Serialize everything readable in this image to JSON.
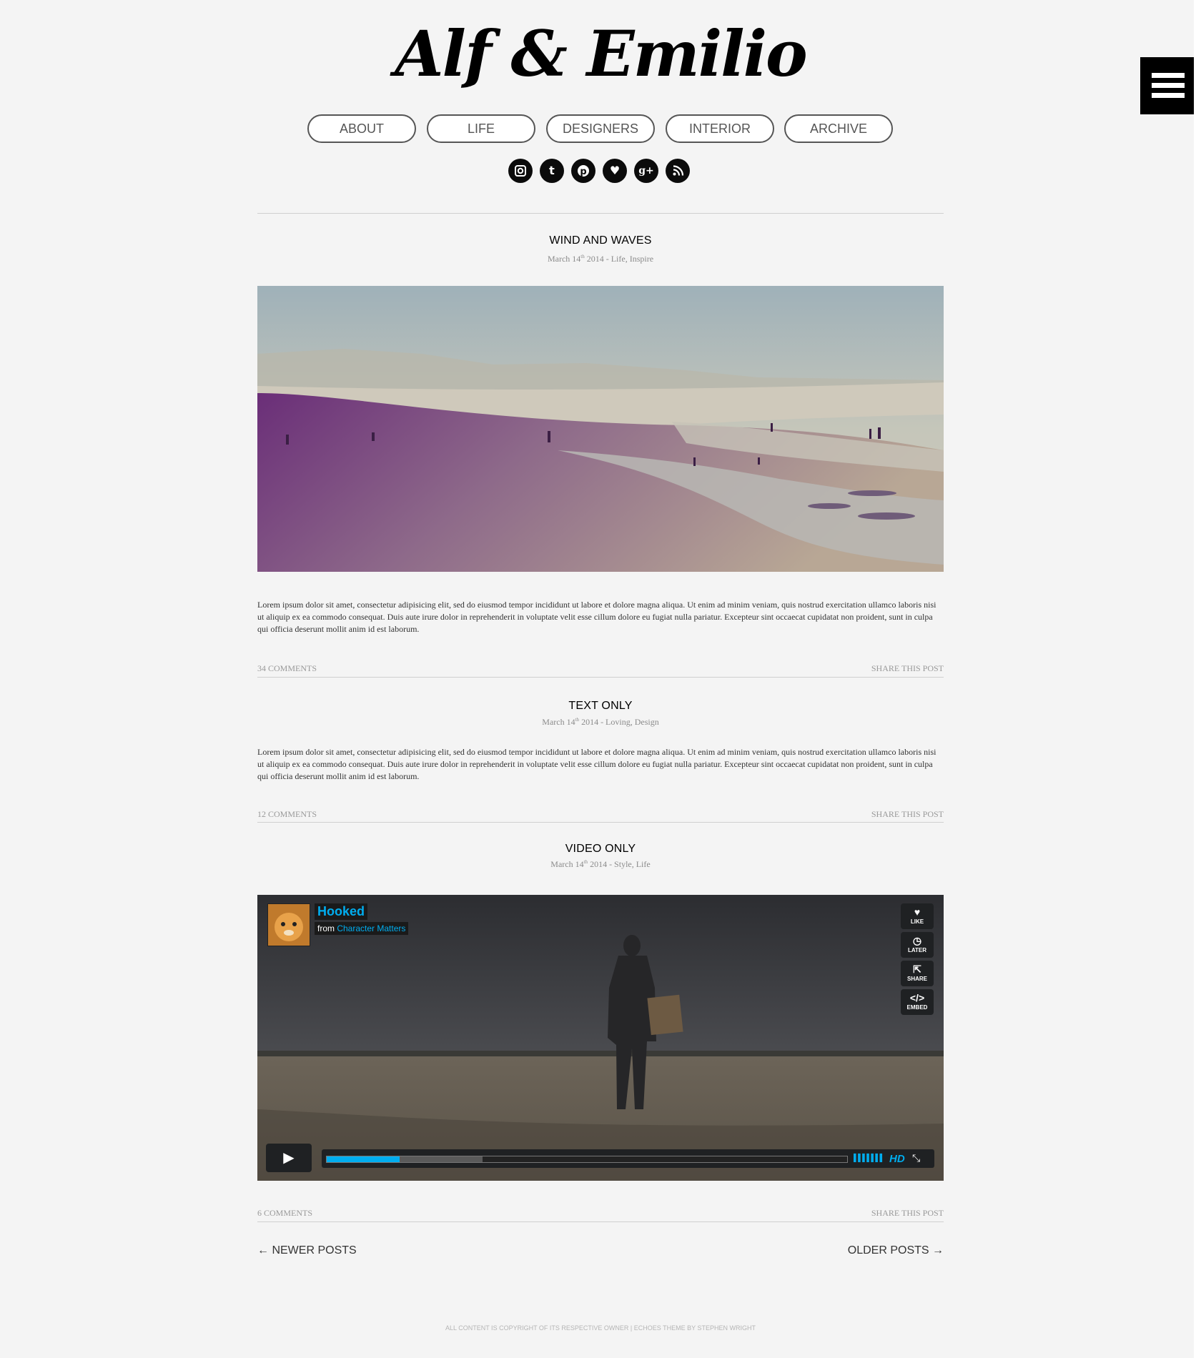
{
  "site": {
    "title": "Alf & Emilio"
  },
  "nav": [
    {
      "label": "About"
    },
    {
      "label": "Life"
    },
    {
      "label": "Designers"
    },
    {
      "label": "Interior"
    },
    {
      "label": "Archive"
    }
  ],
  "social": [
    "instagram-icon",
    "tumblr-icon",
    "pinterest-icon",
    "heart-icon",
    "google-plus-icon",
    "rss-icon"
  ],
  "posts": [
    {
      "title": "Wind and Waves",
      "date_month_day": "March 14",
      "date_suffix": "th",
      "date_year_tags": " 2014 - Life, Inspire",
      "body": "Lorem ipsum dolor sit amet, consectetur adipisicing elit, sed do eiusmod tempor incididunt ut labore et dolore magna aliqua. Ut enim ad minim veniam, quis nostrud exercitation ullamco laboris nisi ut aliquip ex ea commodo consequat. Duis aute irure dolor in reprehenderit in voluptate velit esse cillum dolore eu fugiat nulla pariatur. Excepteur sint occaecat cupidatat non proident, sunt in culpa qui officia deserunt mollit anim id est laborum.",
      "comments": "34 Comments",
      "share": "Share this post"
    },
    {
      "title": "Text Only",
      "date_month_day": "March 14",
      "date_suffix": "th",
      "date_year_tags": " 2014 - Loving, Design",
      "body": "Lorem ipsum dolor sit amet, consectetur adipisicing elit, sed do eiusmod tempor incididunt ut labore et dolore magna aliqua. Ut enim ad minim veniam, quis nostrud exercitation ullamco laboris nisi ut aliquip ex ea commodo consequat. Duis aute irure dolor in reprehenderit in voluptate velit esse cillum dolore eu fugiat nulla pariatur. Excepteur sint occaecat cupidatat non proident, sunt in culpa qui officia deserunt mollit anim id est laborum.",
      "comments": "12 Comments",
      "share": "Share this post"
    },
    {
      "title": "Video Only",
      "date_month_day": "March 14",
      "date_suffix": "th",
      "date_year_tags": " 2014 - Style, Life",
      "comments": "6 Comments",
      "share": "Share this post"
    }
  ],
  "video": {
    "title": "Hooked",
    "from_label": "from",
    "from_channel": "Character Matters",
    "side_buttons": [
      "LIKE",
      "LATER",
      "SHARE",
      "EMBED"
    ],
    "hd_label": "HD",
    "played_fraction": 0.14,
    "loaded_fraction": 0.3
  },
  "pagination": {
    "newer": "← Newer Posts",
    "older": "Older Posts →"
  },
  "footer": {
    "copyright": "All content is copyright of its respective owner | Echoes theme by Stephen Wright"
  },
  "colors": {
    "accent": "#00adef",
    "background": "#f4f4f4"
  }
}
